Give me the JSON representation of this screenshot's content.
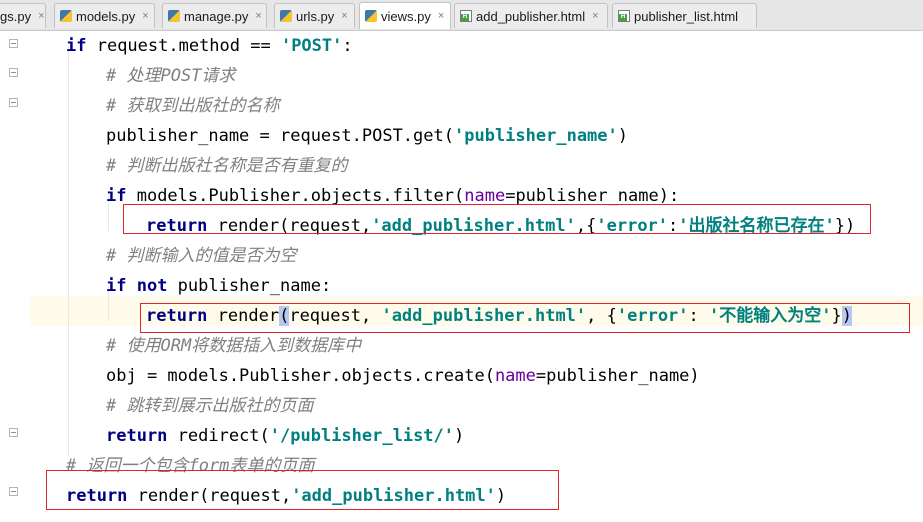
{
  "tabs": [
    {
      "name": "gs.py",
      "type": "py",
      "active": false
    },
    {
      "name": "models.py",
      "type": "py",
      "active": false
    },
    {
      "name": "manage.py",
      "type": "py",
      "active": false
    },
    {
      "name": "urls.py",
      "type": "py",
      "active": false
    },
    {
      "name": "views.py",
      "type": "py",
      "active": true
    },
    {
      "name": "add_publisher.html",
      "type": "html",
      "active": false
    },
    {
      "name": "publisher_list.html",
      "type": "html",
      "active": false
    }
  ],
  "close_glyph": "×",
  "code": {
    "l1": {
      "a": "if",
      "b": " request.method == ",
      "c": "'POST'",
      "d": ":"
    },
    "l2": {
      "c": "# 处理POST请求"
    },
    "l3": {
      "c": "# 获取到出版社的名称"
    },
    "l4": {
      "a": "publisher_name = request.POST.get(",
      "s": "'publisher_name'",
      "b": ")"
    },
    "l5": {
      "c": "# 判断出版社名称是否有重复的"
    },
    "l6": {
      "k": "if",
      "a": " models.Publisher.objects.filter(",
      "p": "name",
      "b": "=publisher_name):"
    },
    "l7": {
      "k": "return",
      "a": " render(request,",
      "s1": "'add_publisher.html'",
      "b": ",{",
      "s2": "'error'",
      "c": ":",
      "s3": "'出版社名称已存在'",
      "d": "})"
    },
    "l8": {
      "c": "# 判断输入的值是否为空"
    },
    "l9": {
      "k1": "if",
      "k2": " not",
      "a": " publisher_name:"
    },
    "l10": {
      "k": "return",
      "a": " render",
      "h1": "(",
      "b": "request, ",
      "s1": "'add_publisher.html'",
      "c": ", {",
      "s2": "'error'",
      "d": ": ",
      "s3": "'不能输入为空'",
      "e": "}",
      "h2": ")"
    },
    "l11": {
      "c": "# 使用ORM将数据插入到数据库中"
    },
    "l12": {
      "a": "obj = models.Publisher.objects.create(",
      "p": "name",
      "b": "=publisher_name)"
    },
    "l13": {
      "c": "# 跳转到展示出版社的页面"
    },
    "l14": {
      "k": "return",
      "a": " redirect(",
      "s": "'/publisher_list/'",
      "b": ")"
    },
    "l15": {
      "c": "# 返回一个包含form表单的页面"
    },
    "l16": {
      "k": "return",
      "a": " render(request,",
      "s": "'add_publisher.html'",
      "b": ")"
    }
  },
  "colors": {
    "keyword": "#000080",
    "string": "#008080",
    "comment": "#808080",
    "param": "#660099",
    "annotation_box": "#e0242c",
    "caret_line": "#fffbea"
  }
}
